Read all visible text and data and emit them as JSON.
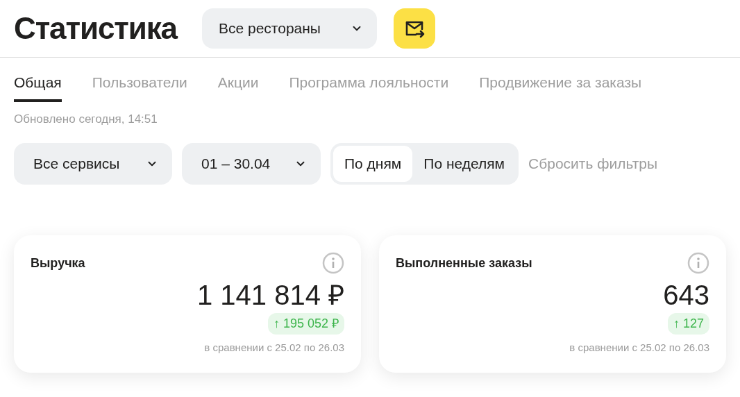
{
  "header": {
    "title": "Статистика",
    "restaurant_select": {
      "value": "Все рестораны"
    }
  },
  "tabs": [
    {
      "label": "Общая",
      "selected": true
    },
    {
      "label": "Пользователи",
      "selected": false
    },
    {
      "label": "Акции",
      "selected": false
    },
    {
      "label": "Программа лояльности",
      "selected": false
    },
    {
      "label": "Продвижение за заказы",
      "selected": false
    }
  ],
  "updated": "Обновлено сегодня, 14:51",
  "filters": {
    "service_select": {
      "value": "Все сервисы"
    },
    "date_select": {
      "value": "01 – 30.04"
    },
    "grouping": [
      {
        "label": "По дням",
        "selected": true
      },
      {
        "label": "По неделям",
        "selected": false
      }
    ],
    "reset": "Сбросить фильтры"
  },
  "cards": [
    {
      "title": "Выручка",
      "value": "1 141 814 ₽",
      "delta": "↑ 195 052 ₽",
      "comparison": "в сравнении с 25.02 по 26.03"
    },
    {
      "title": "Выполненные заказы",
      "value": "643",
      "delta": "↑ 127",
      "comparison": "в сравнении с 25.02 по 26.03"
    }
  ]
}
